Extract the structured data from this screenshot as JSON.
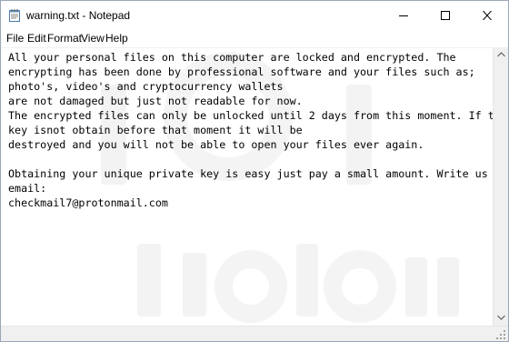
{
  "window": {
    "title": "warning.txt - Notepad"
  },
  "menu": {
    "file": "File",
    "edit": "Edit",
    "format": "Format",
    "view": "View",
    "help": "Help"
  },
  "document": {
    "text": "All your personal files on this computer are locked and encrypted. The\nencrypting has been done by professional software and your files such as;\nphoto's, video's and cryptocurrency wallets\nare not damaged but just not readable for now.\nThe encrypted files can only be unlocked until 2 days from this moment. If the\nkey isnot obtain before that moment it will be\ndestroyed and you will not be able to open your files ever again.\n\nObtaining your unique private key is easy just pay a small amount. Write us to\nemail:\ncheckmail7@protonmail.com"
  },
  "icons": {
    "app": "notepad-icon",
    "minimize": "minimize-icon",
    "maximize": "maximize-icon",
    "close": "close-icon",
    "scroll_up": "scroll-up-arrow-icon",
    "scroll_down": "scroll-down-arrow-icon",
    "resize_grip": "resize-grip-icon"
  },
  "colors": {
    "title_bar": "#ffffff",
    "text": "#000000",
    "scrollbar": "#f0f0f0",
    "window_border": "#9aa6b8"
  }
}
